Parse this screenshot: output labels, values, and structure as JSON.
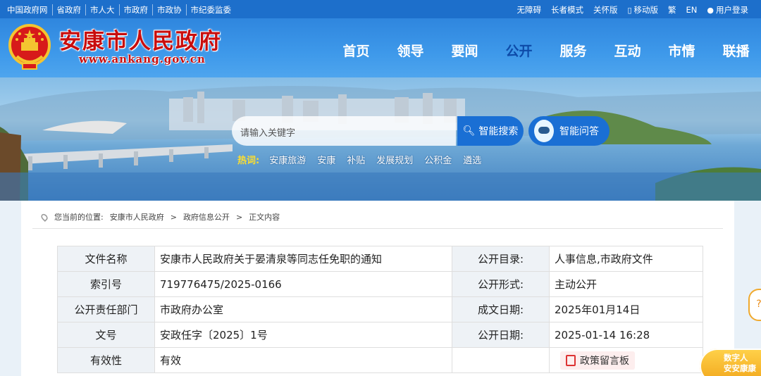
{
  "topbar": {
    "links": [
      "中国政府网",
      "省政府",
      "市人大",
      "市政府",
      "市政协",
      "市纪委监委"
    ],
    "right": {
      "accessibility": "无障碍",
      "elder_mode": "长者模式",
      "care_edition": "关怀版",
      "mobile": "移动版",
      "traditional": "繁",
      "english": "EN",
      "login": "用户登录"
    }
  },
  "header": {
    "title": "安康市人民政府",
    "url": "www.ankang.gov.cn",
    "nav": [
      "首页",
      "领导",
      "要闻",
      "公开",
      "服务",
      "互动",
      "市情",
      "联播"
    ],
    "active_nav": "公开"
  },
  "search": {
    "placeholder": "请输入关键字",
    "search_button": "智能搜索",
    "qa_button": "智能问答",
    "hot_label": "热词:",
    "hot_words": [
      "安康旅游",
      "安康",
      "补贴",
      "发展规划",
      "公积金",
      "遴选"
    ]
  },
  "breadcrumb": {
    "prefix": "您当前的位置:",
    "items": [
      "安康市人民政府",
      "政府信息公开",
      "正文内容"
    ],
    "separator": ">"
  },
  "meta_table": {
    "rows": [
      {
        "k1": "文件名称",
        "v1": "安康市人民政府关于晏清泉等同志任免职的通知",
        "k2": "公开目录:",
        "v2": "人事信息,市政府文件"
      },
      {
        "k1": "索引号",
        "v1": "719776475/2025-0166",
        "k2": "公开形式:",
        "v2": "主动公开"
      },
      {
        "k1": "公开责任部门",
        "v1": "市政府办公室",
        "k2": "成文日期:",
        "v2": "2025年01月14日"
      },
      {
        "k1": "文号",
        "v1": "安政任字〔2025〕1号",
        "k2": "公开日期:",
        "v2": "2025-01-14 16:28"
      },
      {
        "k1": "有效性",
        "v1": "有效",
        "k2": "",
        "v2": "政策留言板"
      }
    ]
  },
  "side": {
    "digital_line1": "数字人",
    "digital_line2": "安安康康"
  },
  "colors": {
    "topbar": "#1d6fcb",
    "title_red": "#c80d0d",
    "search_blue": "#1a6fd4",
    "active_nav": "#0d4aa8"
  }
}
